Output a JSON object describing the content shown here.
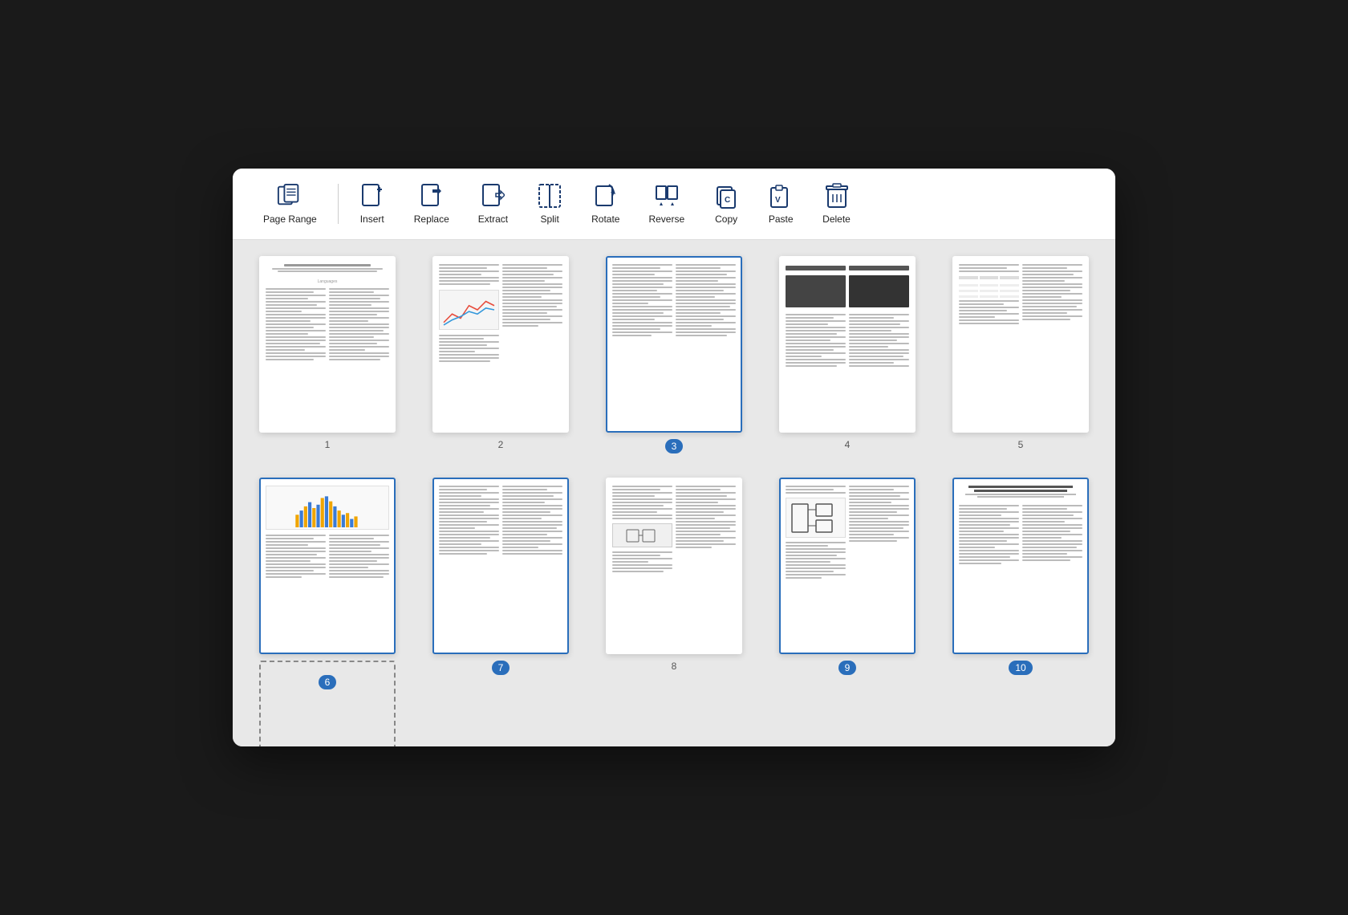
{
  "toolbar": {
    "items": [
      {
        "id": "page-range",
        "label": "Page Range",
        "icon": "page-range-icon"
      },
      {
        "id": "insert",
        "label": "Insert",
        "icon": "insert-icon"
      },
      {
        "id": "replace",
        "label": "Replace",
        "icon": "replace-icon"
      },
      {
        "id": "extract",
        "label": "Extract",
        "icon": "extract-icon"
      },
      {
        "id": "split",
        "label": "Split",
        "icon": "split-icon"
      },
      {
        "id": "rotate",
        "label": "Rotate",
        "icon": "rotate-icon"
      },
      {
        "id": "reverse",
        "label": "Reverse",
        "icon": "reverse-icon"
      },
      {
        "id": "copy",
        "label": "Copy",
        "icon": "copy-icon"
      },
      {
        "id": "paste",
        "label": "Paste",
        "icon": "paste-icon"
      },
      {
        "id": "delete",
        "label": "Delete",
        "icon": "delete-icon"
      }
    ]
  },
  "pages": [
    {
      "number": "1",
      "selected": false,
      "badge": false,
      "type": "text-two-col"
    },
    {
      "number": "2",
      "selected": false,
      "badge": false,
      "type": "text-graph"
    },
    {
      "number": "3",
      "selected": true,
      "badge": true,
      "type": "text-two-col"
    },
    {
      "number": "4",
      "selected": false,
      "badge": false,
      "type": "dark-text"
    },
    {
      "number": "5",
      "selected": false,
      "badge": false,
      "type": "text-table"
    },
    {
      "number": "6",
      "selected": true,
      "badge": true,
      "type": "chart-text",
      "drag": true
    },
    {
      "number": "7",
      "selected": true,
      "badge": true,
      "type": "text-two-col",
      "drag": true
    },
    {
      "number": "8",
      "selected": false,
      "badge": false,
      "type": "text-two-col"
    },
    {
      "number": "9",
      "selected": true,
      "badge": true,
      "type": "diagram-text"
    },
    {
      "number": "10",
      "selected": true,
      "badge": true,
      "type": "text-two-col-title"
    }
  ],
  "accent_color": "#2a6ebb"
}
